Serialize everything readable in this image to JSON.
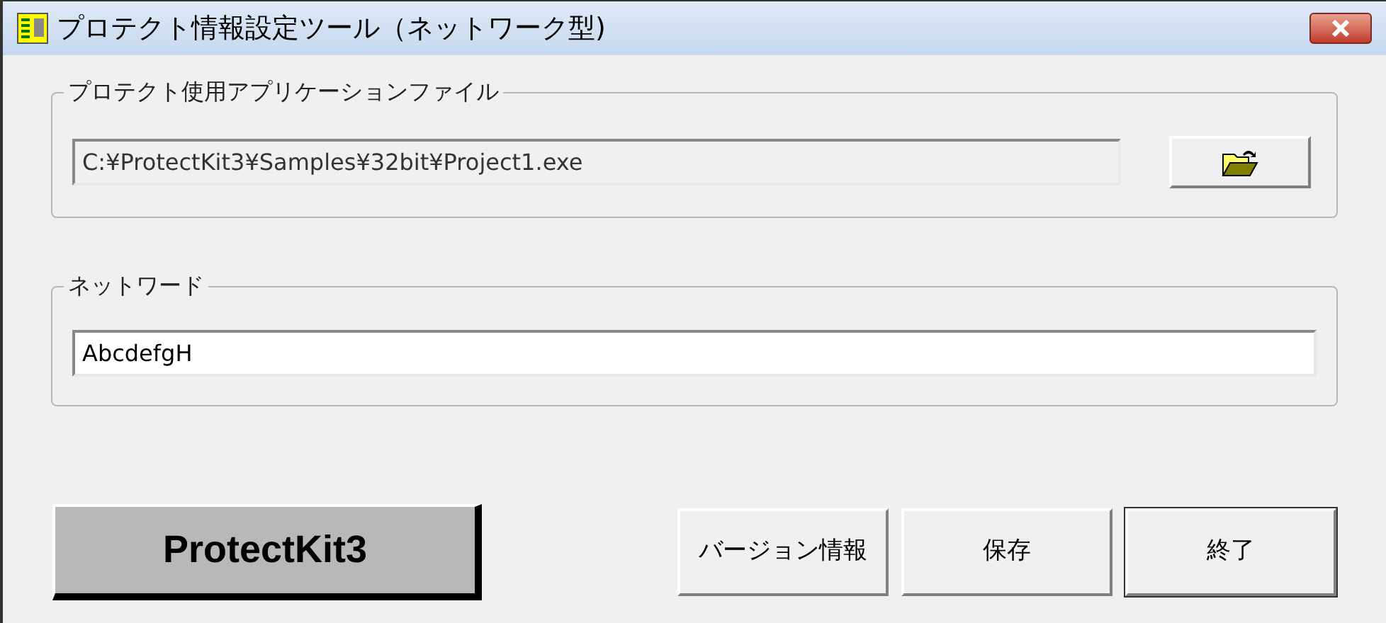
{
  "window": {
    "title": "プロテクト情報設定ツール（ネットワーク型)"
  },
  "groups": [
    {
      "label": "プロテクト使用アプリケーションファイル",
      "field": {
        "value": "C:¥ProtectKit3¥Samples¥32bit¥Project1.exe",
        "disabled": true
      },
      "browse": true
    },
    {
      "label": "ネットワード",
      "field": {
        "value": "AbcdefgH",
        "disabled": false
      },
      "browse": false
    }
  ],
  "logo": "ProtectKit3",
  "buttons": [
    {
      "label": "バージョン情報",
      "default": false
    },
    {
      "label": "保存",
      "default": false
    },
    {
      "label": "終了",
      "default": true
    }
  ]
}
